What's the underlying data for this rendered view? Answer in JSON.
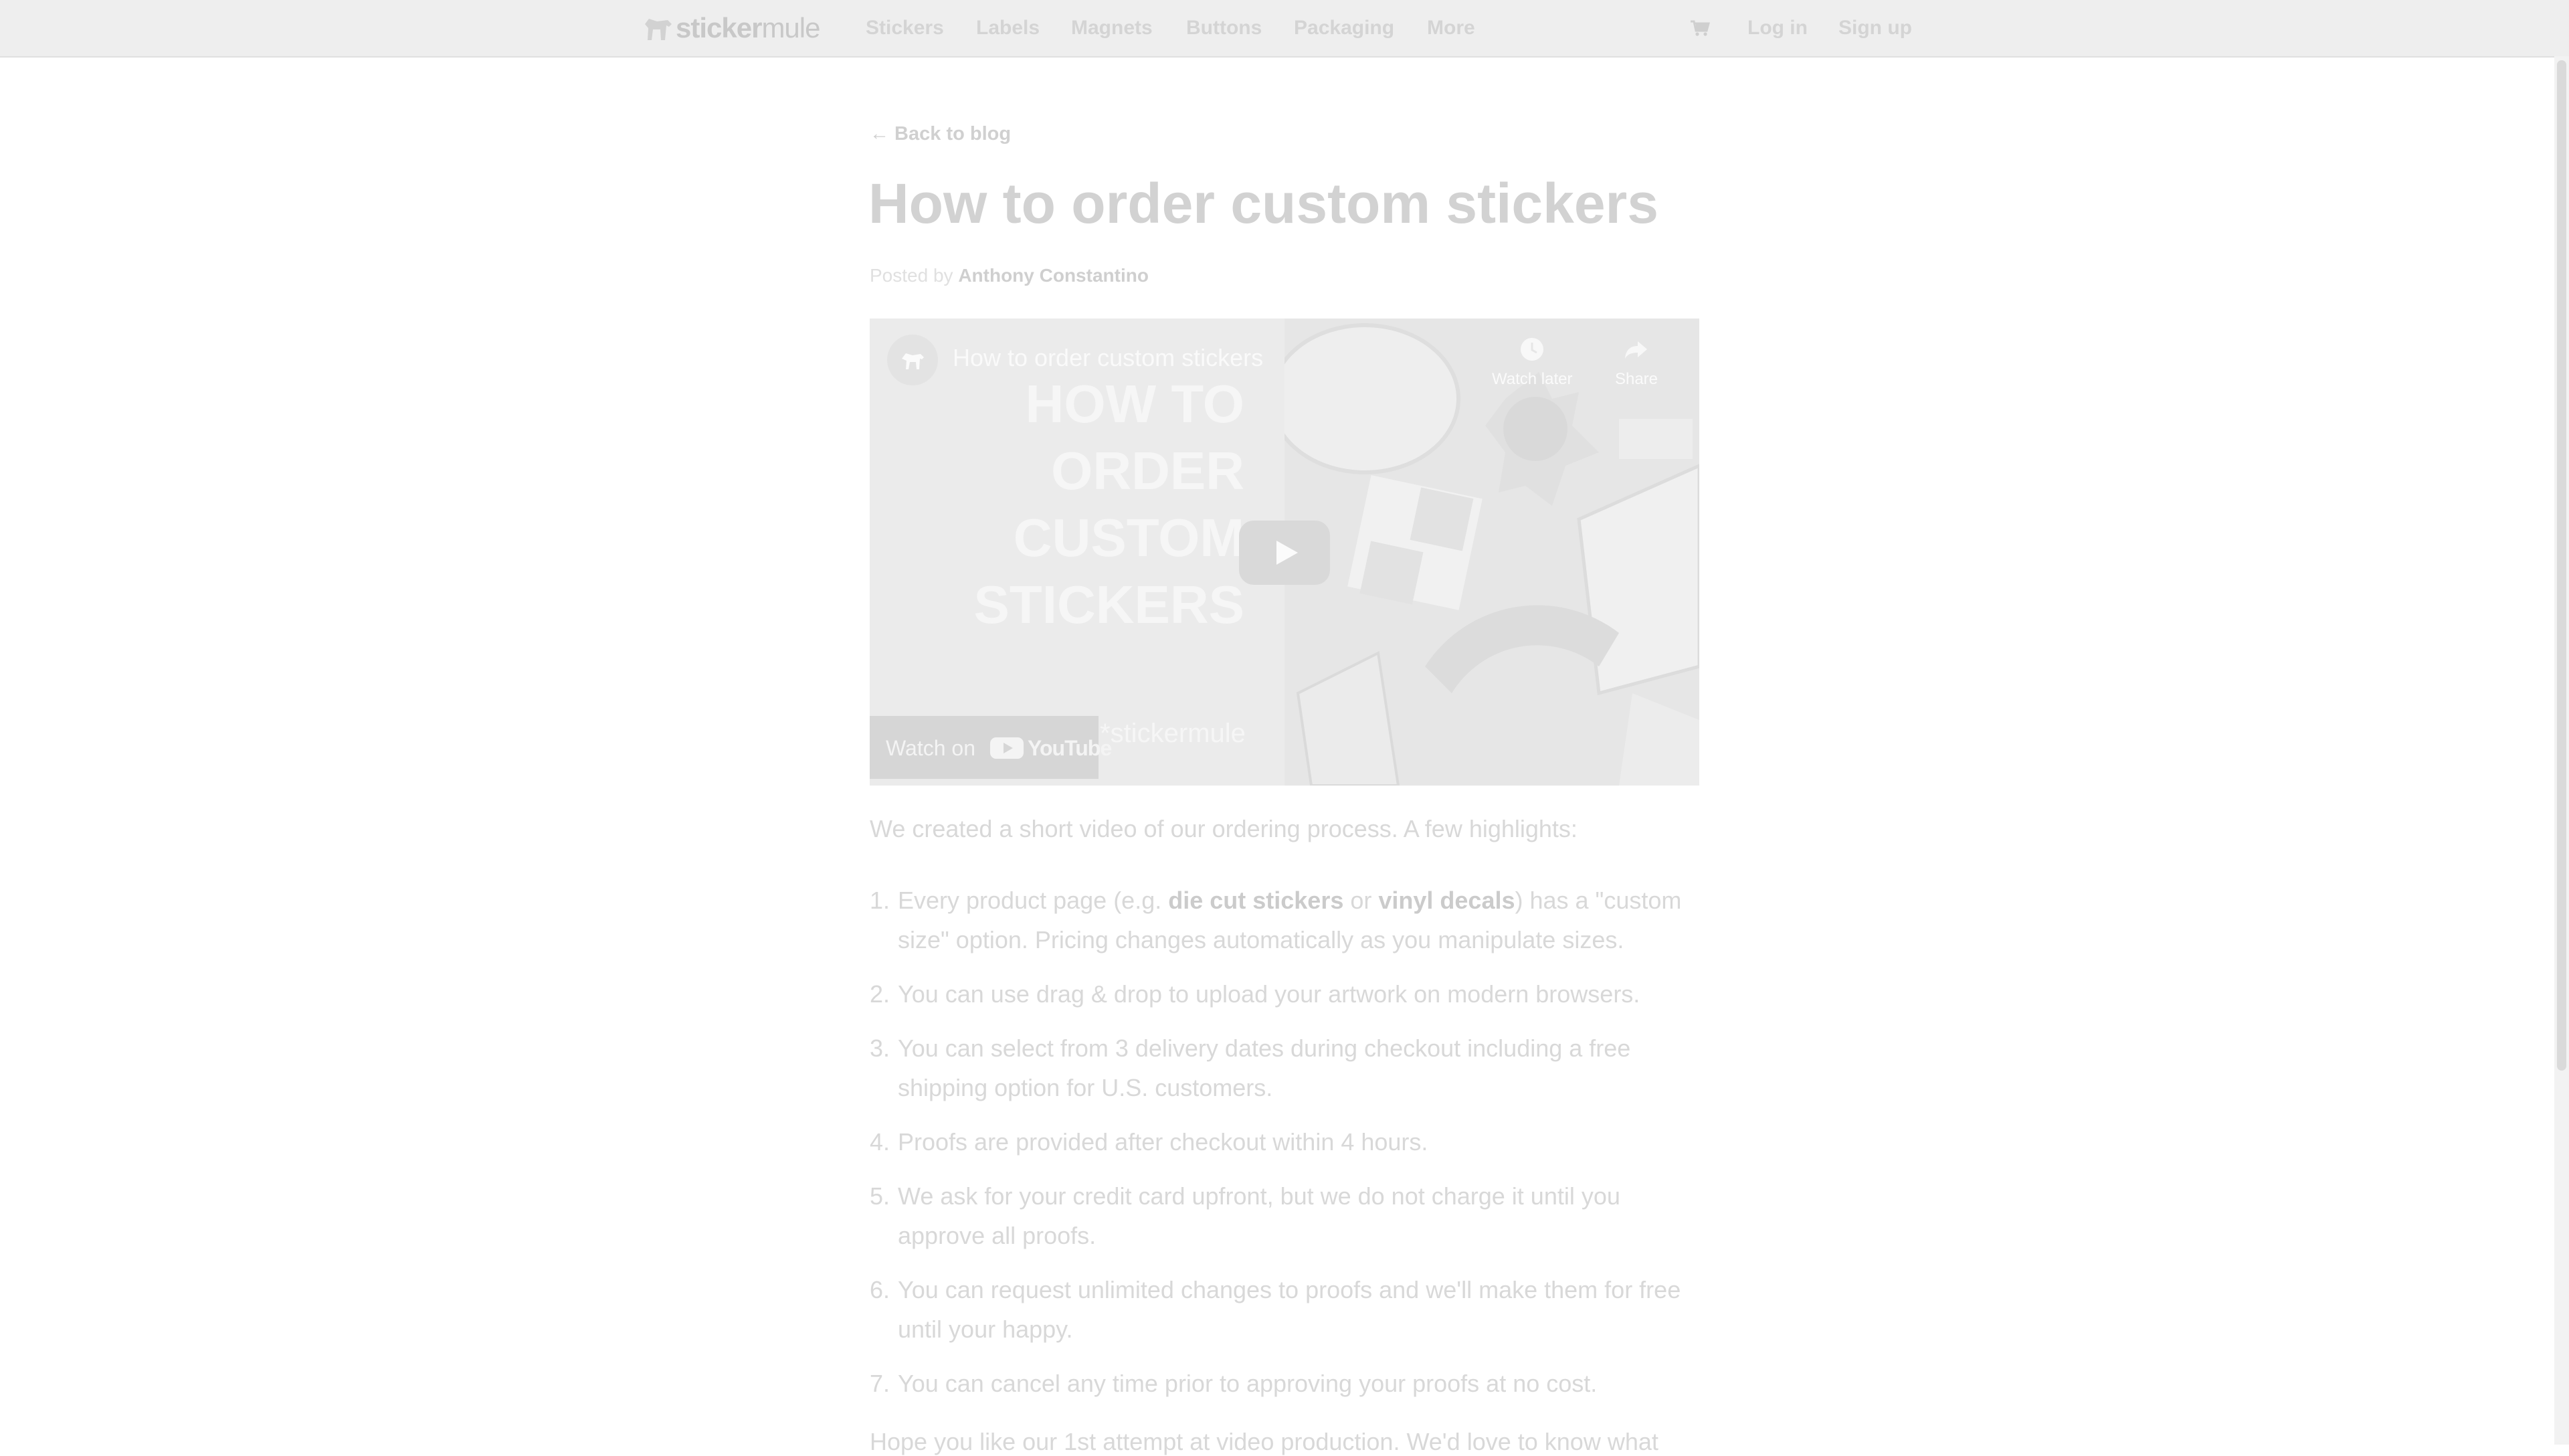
{
  "nav": {
    "logo_bold": "sticker",
    "logo_light": "mule",
    "items": [
      "Stickers",
      "Labels",
      "Magnets",
      "Buttons",
      "Packaging",
      "More"
    ],
    "cart_icon": "cart-icon",
    "login": "Log in",
    "signup": "Sign up"
  },
  "article": {
    "back_link": "← Back to blog",
    "title": "How to order custom stickers",
    "posted_by": "Posted by",
    "author": "Anthony Constantino"
  },
  "video": {
    "title": "How to order custom stickers",
    "hero_lines": [
      "HOW TO",
      "ORDER",
      "CUSTOM",
      "STICKERS"
    ],
    "watch_later": "Watch later",
    "share": "Share",
    "watch_on": "Watch on",
    "youtube": "YouTube",
    "brand": "*stickermule"
  },
  "body": {
    "intro": "We created a short video of our ordering process. A few highlights:",
    "item1_pre": "Every product page (e.g. ",
    "item1_link1": "die cut stickers",
    "item1_mid": " or ",
    "item1_link2": "vinyl decals",
    "item1_post": ") has a \"custom size\" option. Pricing changes automatically as you manipulate sizes.",
    "items": [
      "You can use drag & drop to upload your artwork on modern browsers.",
      "You can select from 3 delivery dates during checkout including a free shipping option for U.S. customers.",
      "Proofs are provided after checkout within 4 hours.",
      "We ask for your credit card upfront, but we do not charge it until you approve all proofs.",
      "You can request unlimited changes to proofs and we'll make them for free until your happy.",
      "You can cancel any time prior to approving your proofs at no cost."
    ],
    "numbers": [
      "1.",
      "2.",
      "3.",
      "4.",
      "5.",
      "6.",
      "7."
    ],
    "cutoff_line": "Hope you like our 1st attempt at video production. We'd love to know what"
  }
}
